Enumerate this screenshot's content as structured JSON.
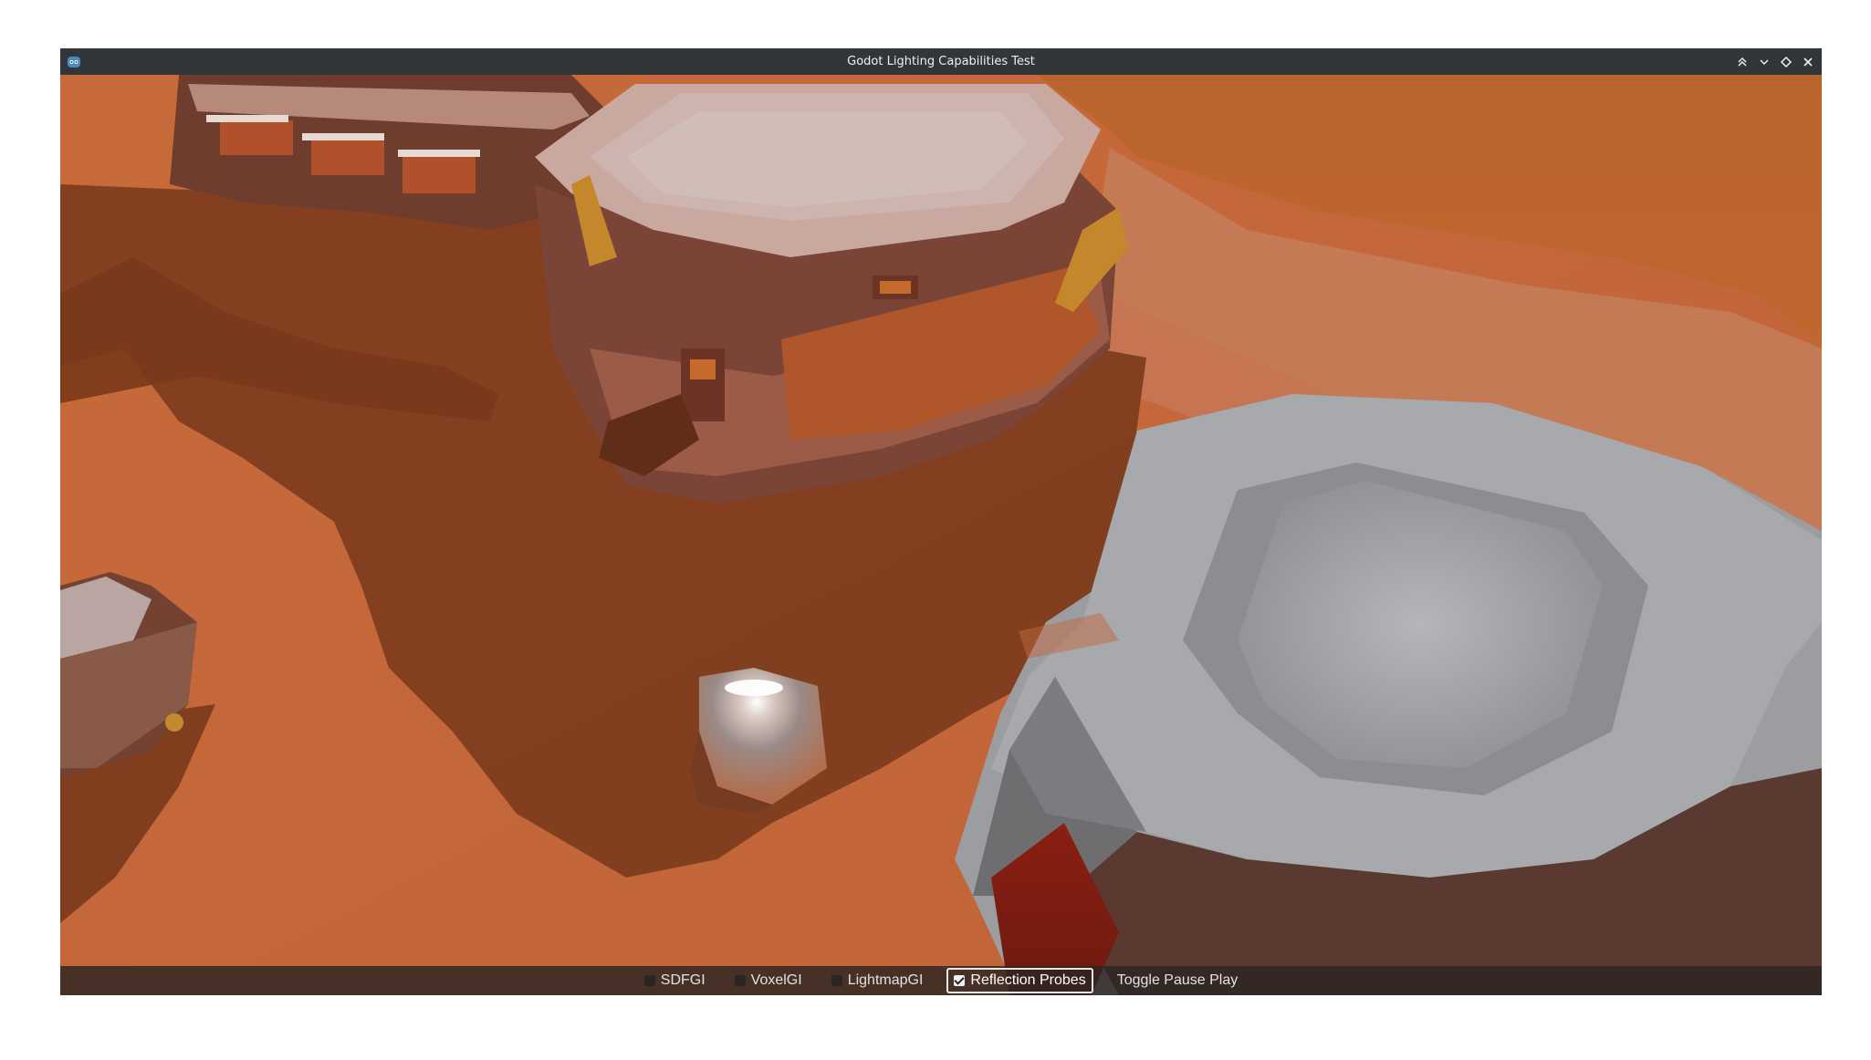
{
  "window": {
    "title": "Godot Lighting Capabilities Test",
    "icon": "godot-icon",
    "controls": [
      "keep-above-icon",
      "minimize-icon",
      "maximize-icon",
      "close-icon"
    ]
  },
  "hud": {
    "toggles": [
      {
        "label": "SDFGI",
        "checked": false
      },
      {
        "label": "VoxelGI",
        "checked": false
      },
      {
        "label": "LightmapGI",
        "checked": false
      },
      {
        "label": "Reflection Probes",
        "checked": true
      }
    ],
    "pause_button": "Toggle Pause Play"
  },
  "colors": {
    "ground": "#c4693b",
    "shadow": "#7c3b1c",
    "titlebar": "#31363b",
    "building_top": "#a9aaad"
  }
}
